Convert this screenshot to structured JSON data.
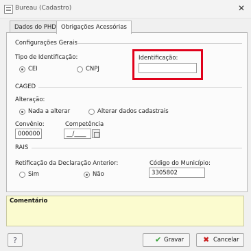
{
  "window": {
    "title": "Bureau (Cadastro)",
    "close_glyph": "✕",
    "app_icon": "form-icon"
  },
  "tabs": [
    {
      "label": "Dados do PHD",
      "active": false
    },
    {
      "label": "Obrigações Acessórias",
      "active": true
    }
  ],
  "config_gerais": {
    "title": "Configurações Gerais",
    "tipo_label": "Tipo de Identificação:",
    "options": [
      {
        "label": "CEI",
        "selected": true
      },
      {
        "label": "CNPJ",
        "selected": false
      }
    ],
    "identificacao_label": "Identificação:",
    "identificacao_value": ""
  },
  "caged": {
    "title": "CAGED",
    "alteracao_label": "Alteração:",
    "options": [
      {
        "label": "Nada a alterar",
        "selected": true
      },
      {
        "label": "Alterar dados cadastrais",
        "selected": false
      }
    ],
    "convenio_label": "Convênio:",
    "convenio_value": "0000000",
    "competencia_label": "Competência",
    "competencia_value": "__/____"
  },
  "rais": {
    "title": "RAIS",
    "retificacao_label": "Retificação da Declaração Anterior:",
    "options": [
      {
        "label": "Sim",
        "selected": false
      },
      {
        "label": "Não",
        "selected": true
      }
    ],
    "municipio_label": "Código do Município:",
    "municipio_value": "3305802"
  },
  "comentario": {
    "title": "Comentário",
    "value": ""
  },
  "buttons": {
    "help": "?",
    "save": "Gravar",
    "cancel": "Cancelar"
  },
  "colors": {
    "highlight": "#e0001a",
    "comment_bg": "#fbfbcf",
    "save_check": "#2f9e2f",
    "cancel_x": "#c81e1e"
  }
}
